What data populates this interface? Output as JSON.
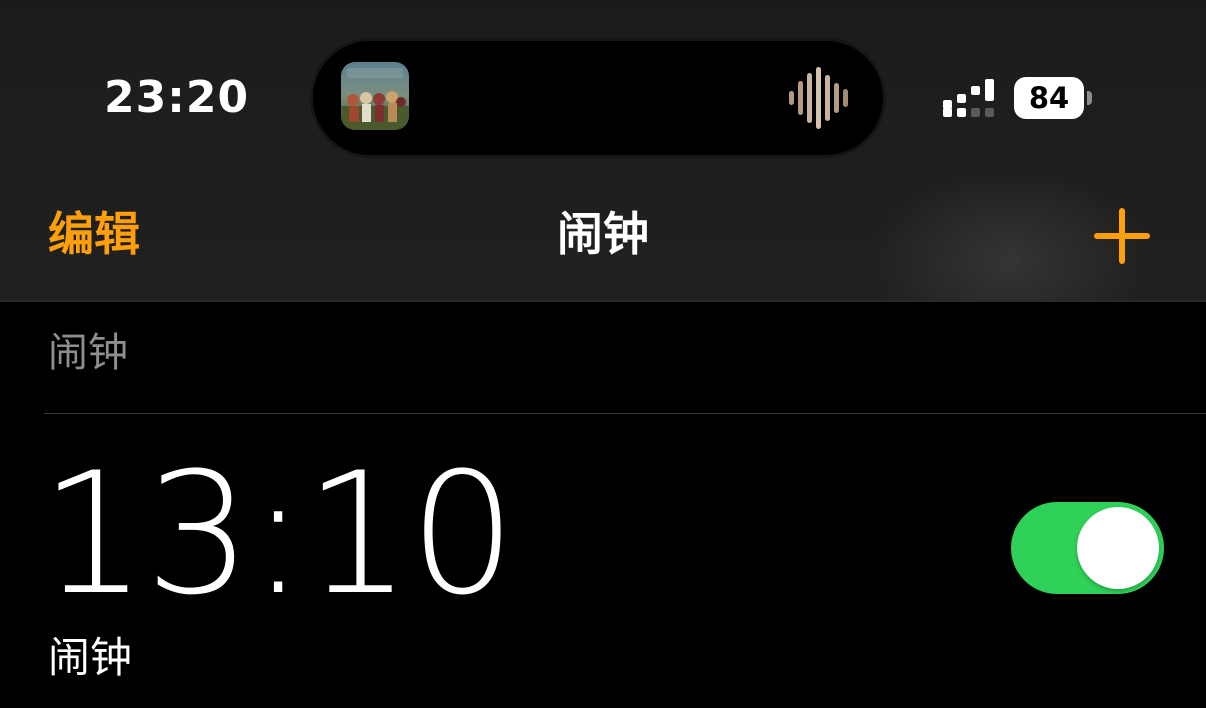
{
  "status_bar": {
    "time": "23:20",
    "battery_level": "84",
    "icons": [
      "album-art-icon",
      "audio-waveform-icon",
      "cellular-signal-icon",
      "battery-icon"
    ]
  },
  "nav": {
    "edit_label": "编辑",
    "title": "闹钟",
    "add_icon": "plus-icon"
  },
  "alarms_section": {
    "header": "闹钟",
    "alarms": [
      {
        "time": "13:10",
        "label": "闹钟",
        "enabled": true
      }
    ]
  },
  "colors": {
    "accent": "#ff9f0a",
    "toggle_on": "#30d158",
    "secondary_text": "#8d8d92",
    "background": "#000000"
  }
}
